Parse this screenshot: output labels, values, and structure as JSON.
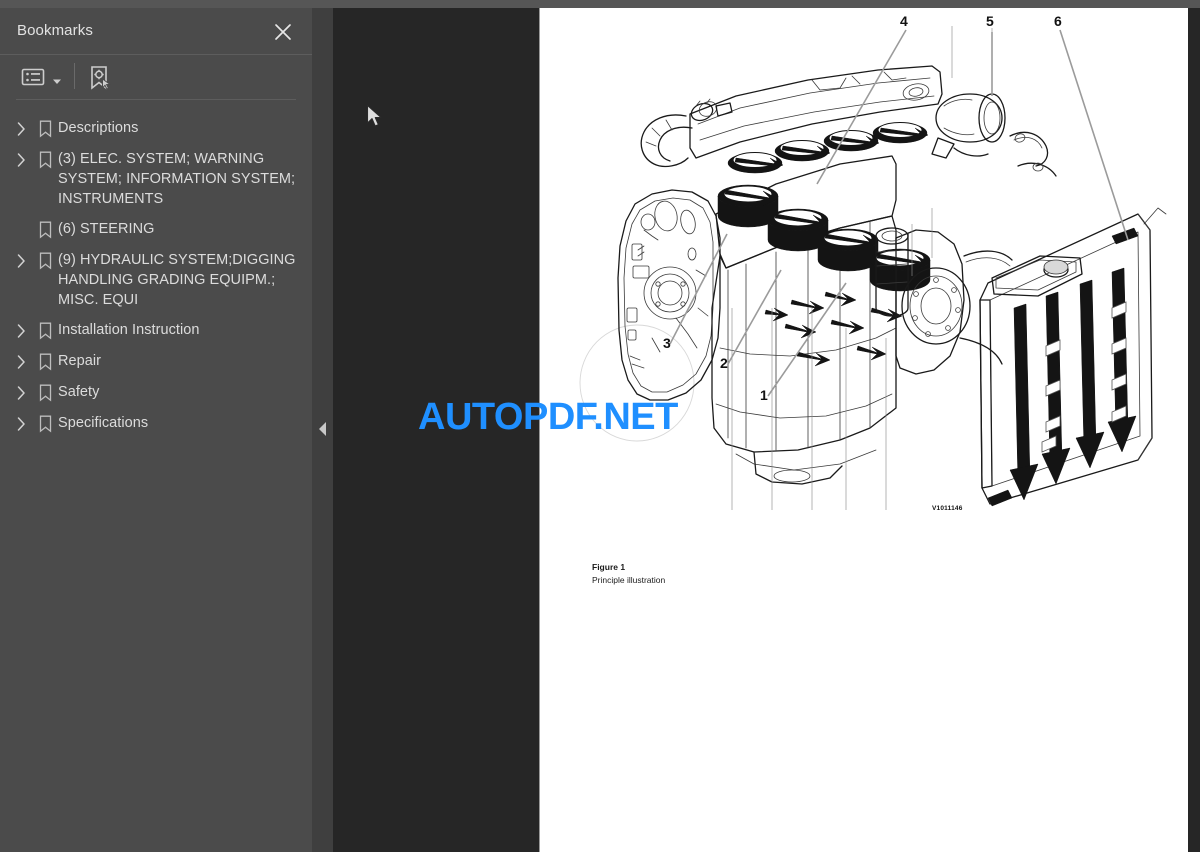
{
  "sidebar": {
    "title": "Bookmarks",
    "close_icon": "close-icon",
    "toolbar": {
      "list_options_icon": "list-options-icon",
      "dropdown_caret_icon": "chevron-down-icon",
      "new_bookmark_icon": "new-bookmark-icon"
    },
    "items": [
      {
        "label": "Descriptions",
        "expandable": true
      },
      {
        "label": "(3) ELEC. SYSTEM; WARNING SYSTEM; INFORMATION SYSTEM; INSTRUMENTS",
        "expandable": true
      },
      {
        "label": "(6) STEERING",
        "expandable": false
      },
      {
        "label": "(9) HYDRAULIC SYSTEM;DIGGING HANDLING GRADING EQUIPM.; MISC. EQUI",
        "expandable": true
      },
      {
        "label": "Installation Instruction",
        "expandable": true
      },
      {
        "label": "Repair",
        "expandable": true
      },
      {
        "label": "Safety",
        "expandable": true
      },
      {
        "label": "Specifications",
        "expandable": true
      }
    ]
  },
  "viewer": {
    "collapse_icon": "collapse-panel-arrow-icon",
    "cursor_icon": "mouse-pointer-icon",
    "page": {
      "figure": {
        "title": "Figure 1",
        "subtitle": "Principle illustration",
        "image_code": "V1011146",
        "callouts": [
          "1",
          "2",
          "3",
          "4",
          "5",
          "6"
        ]
      }
    }
  },
  "watermark": {
    "text_part1": "AUTOPDF",
    "text_part2": ".NET",
    "color": "#1f8fff"
  },
  "colors": {
    "sidebar_bg": "#4b4b4b",
    "viewer_bg": "#262626",
    "page_bg": "#ffffff",
    "text": "#dcdcdc",
    "accent": "#1f8fff"
  }
}
